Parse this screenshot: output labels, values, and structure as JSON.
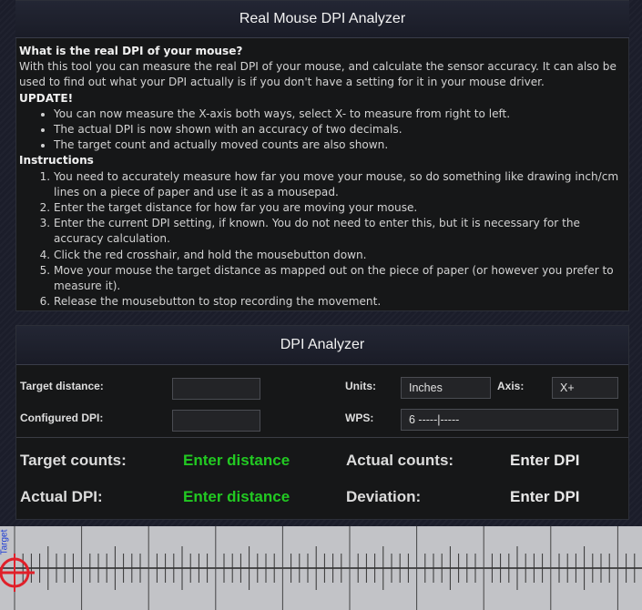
{
  "info": {
    "title": "Real Mouse DPI Analyzer",
    "question": "What is the real DPI of your mouse?",
    "intro": "With this tool you can measure the real DPI of your mouse, and calculate the sensor accuracy. It can also be used to find out what your DPI actually is if you don't have a setting for it in your mouse driver.",
    "update_heading": "UPDATE!",
    "updates": [
      "You can now measure the X-axis both ways, select X- to measure from right to left.",
      "The actual DPI is now shown with an accuracy of two decimals.",
      "The target count and actually moved counts are also shown."
    ],
    "instructions_heading": "Instructions",
    "instructions": [
      "You need to accurately measure how far you move your mouse, so do something like drawing inch/cm lines on a piece of paper and use it as a mousepad.",
      "Enter the target distance for how far you are moving your mouse.",
      "Enter the current DPI setting, if known. You do not need to enter this, but it is necessary for the accuracy calculation.",
      "Click the red crosshair, and hold the mousebutton down.",
      "Move your mouse the target distance as mapped out on the piece of paper (or however you prefer to measure it).",
      "Release the mousebutton to stop recording the movement."
    ]
  },
  "analyzer": {
    "title": "DPI Analyzer",
    "target_distance_label": "Target distance:",
    "target_distance_value": "",
    "configured_dpi_label": "Configured DPI:",
    "configured_dpi_value": "",
    "units_label": "Units:",
    "units_value": "Inches",
    "axis_label": "Axis:",
    "axis_value": "X+",
    "wps_label": "WPS:",
    "wps_value": "6  -----|-----",
    "results": {
      "target_counts_label": "Target counts:",
      "target_counts_value": "Enter distance",
      "actual_counts_label": "Actual counts:",
      "actual_counts_value": "Enter DPI",
      "actual_dpi_label": "Actual DPI:",
      "actual_dpi_value": "Enter distance",
      "deviation_label": "Deviation:",
      "deviation_value": "Enter DPI"
    },
    "colors": {
      "pending_distance": "#22c922",
      "pending_dpi": "#e8e8e8"
    }
  },
  "ruler": {
    "target_label": "Target",
    "crosshair_color": "#e0202a"
  }
}
